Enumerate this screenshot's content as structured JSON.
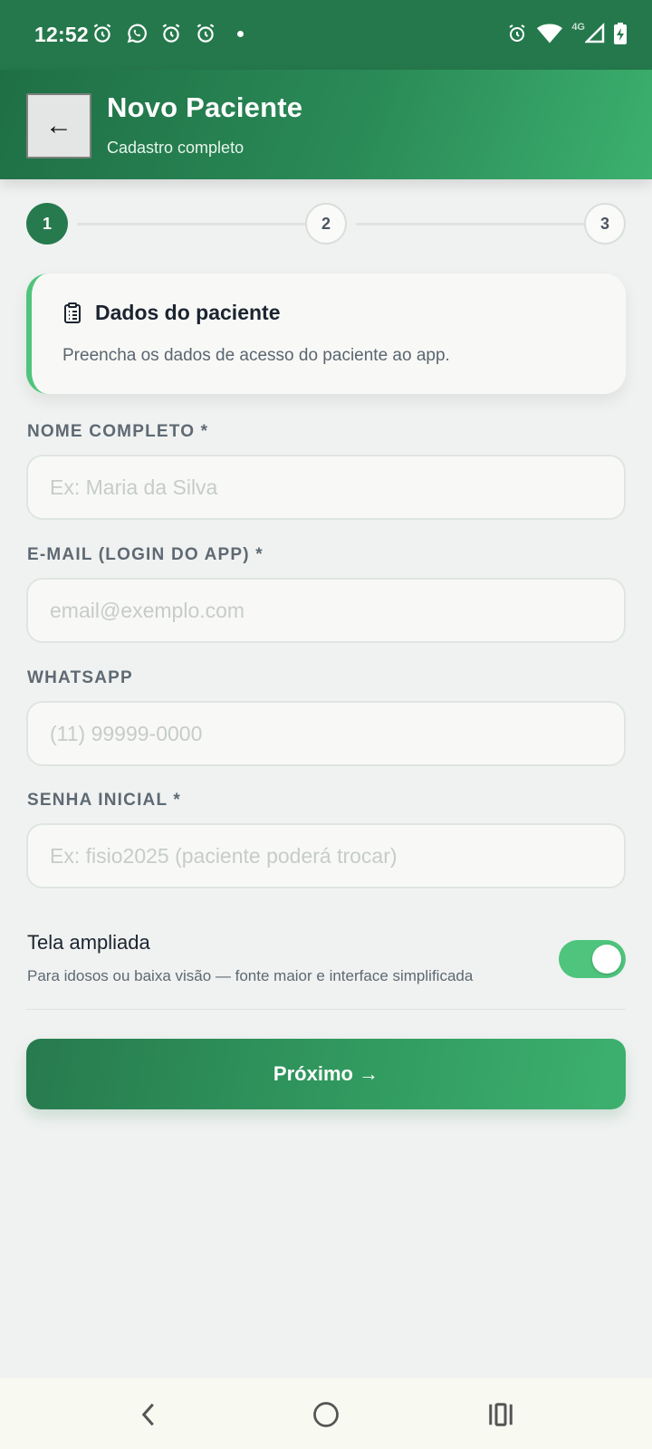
{
  "status_bar": {
    "time": "12:52",
    "left_icons": [
      "alarm-icon",
      "whatsapp-icon",
      "alarm-icon",
      "alarm-icon",
      "dot-icon"
    ],
    "right_icons": [
      "alarm-icon",
      "wifi-icon",
      "signal-icon",
      "battery-charging-icon"
    ],
    "network_label": "4G"
  },
  "header": {
    "back_label": "←",
    "title": "Novo Paciente",
    "subtitle": "Cadastro completo"
  },
  "stepper": {
    "steps": [
      {
        "label": "1",
        "active": true
      },
      {
        "label": "2",
        "active": false
      },
      {
        "label": "3",
        "active": false
      }
    ]
  },
  "info_card": {
    "icon": "clipboard-icon",
    "title": "Dados do paciente",
    "description": "Preencha os dados de acesso do paciente ao app."
  },
  "form": {
    "fields": [
      {
        "label": "NOME COMPLETO *",
        "placeholder": "Ex: Maria da Silva",
        "value": ""
      },
      {
        "label": "E-MAIL (LOGIN DO APP) *",
        "placeholder": "email@exemplo.com",
        "value": ""
      },
      {
        "label": "WHATSAPP",
        "placeholder": "(11) 99999-0000",
        "value": ""
      },
      {
        "label": "SENHA INICIAL *",
        "placeholder": "Ex: fisio2025 (paciente poderá trocar)",
        "value": ""
      }
    ]
  },
  "accessibility_toggle": {
    "title": "Tela ampliada",
    "description": "Para idosos ou baixa visão — fonte maior e interface simplificada",
    "enabled": true
  },
  "next_button": {
    "label": "Próximo →"
  },
  "colors": {
    "primary": "#277a4e",
    "accent": "#4fc47d",
    "status_bar": "#25784c",
    "background": "#f0f2f1"
  },
  "nav_bar": {
    "buttons": [
      "back-nav-icon",
      "home-nav-icon",
      "recents-nav-icon"
    ]
  }
}
